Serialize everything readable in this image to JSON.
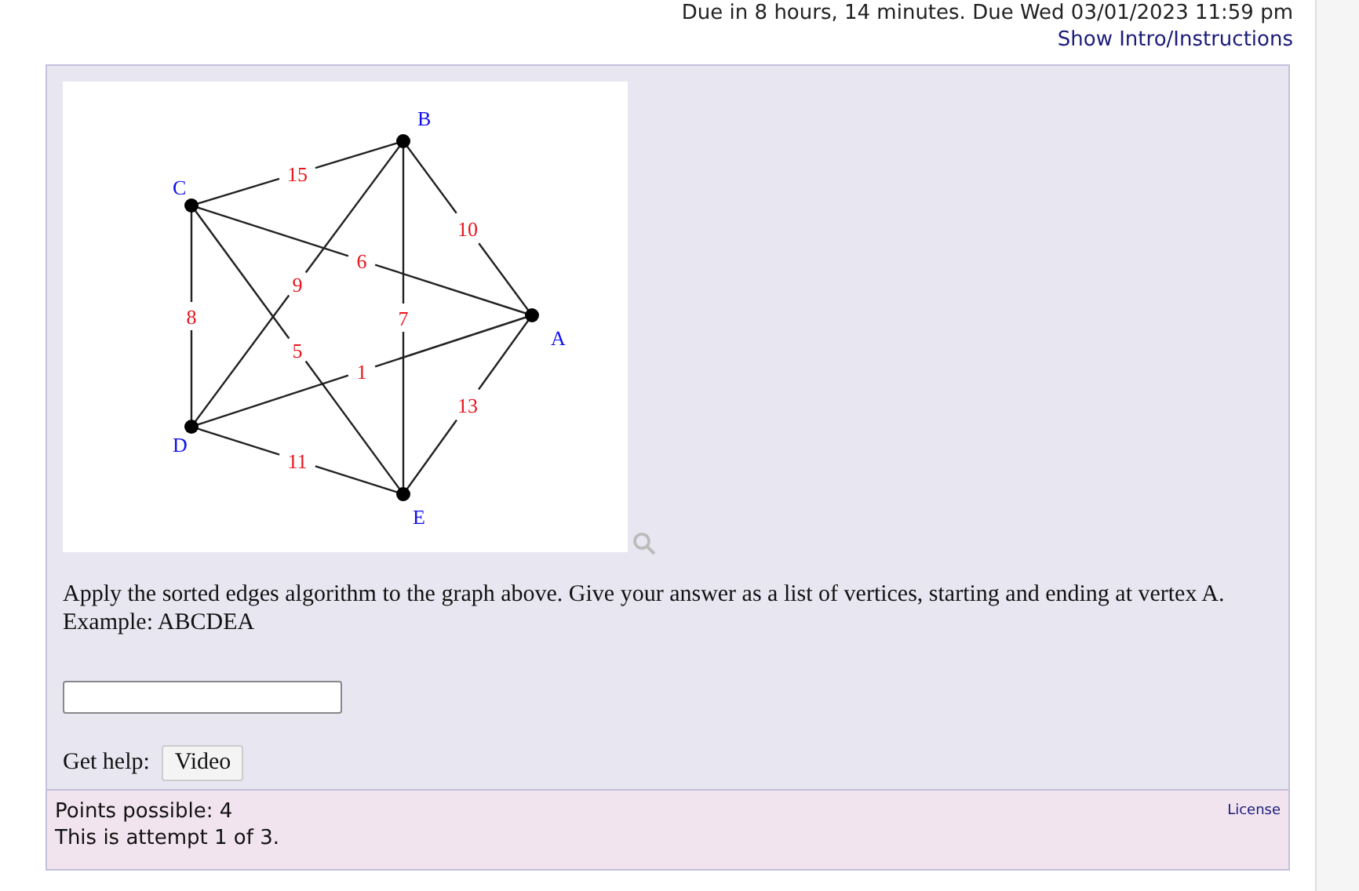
{
  "header": {
    "due_text": "Due in 8 hours, 14 minutes. Due Wed 03/01/2023 11:59 pm",
    "intro_link": "Show Intro/Instructions"
  },
  "graph": {
    "nodes": [
      {
        "name": "A"
      },
      {
        "name": "B"
      },
      {
        "name": "C"
      },
      {
        "name": "D"
      },
      {
        "name": "E"
      }
    ],
    "edges": [
      {
        "weight": "15"
      },
      {
        "weight": "10"
      },
      {
        "weight": "6"
      },
      {
        "weight": "9"
      },
      {
        "weight": "7"
      },
      {
        "weight": "8"
      },
      {
        "weight": "5"
      },
      {
        "weight": "1"
      },
      {
        "weight": "13"
      },
      {
        "weight": "11"
      }
    ]
  },
  "question": {
    "text": "Apply the sorted edges algorithm to the graph above. Give your answer as a list of vertices, starting and ending at vertex A. Example: ABCDEA"
  },
  "help": {
    "label": "Get help:",
    "button": "Video"
  },
  "footer": {
    "points": "Points possible: 4",
    "attempt": "This is attempt 1 of 3.",
    "license": "License"
  }
}
